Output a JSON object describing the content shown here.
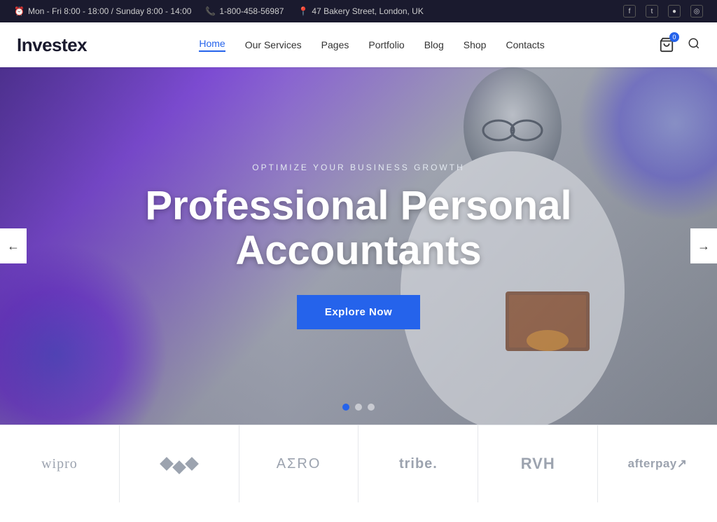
{
  "topbar": {
    "hours": "Mon - Fri 8:00 - 18:00 / Sunday 8:00 - 14:00",
    "phone": "1-800-458-56987",
    "address": "47 Bakery Street, London, UK"
  },
  "header": {
    "logo": "Investex",
    "nav": [
      {
        "label": "Home",
        "active": true
      },
      {
        "label": "Our Services",
        "active": false
      },
      {
        "label": "Pages",
        "active": false
      },
      {
        "label": "Portfolio",
        "active": false
      },
      {
        "label": "Blog",
        "active": false
      },
      {
        "label": "Shop",
        "active": false
      },
      {
        "label": "Contacts",
        "active": false
      }
    ],
    "cart_count": "0"
  },
  "hero": {
    "subtitle": "Optimize Your Business Growth",
    "title": "Professional Personal Accountants",
    "button_label": "Explore Now",
    "dots": [
      {
        "active": true
      },
      {
        "active": false
      },
      {
        "active": false
      }
    ],
    "arrow_left": "←",
    "arrow_right": "→"
  },
  "clients": [
    {
      "label": "wipro",
      "type": "text"
    },
    {
      "label": "◆◆◆",
      "type": "diamonds"
    },
    {
      "label": "AΣRO",
      "type": "text"
    },
    {
      "label": "tribe.",
      "type": "text"
    },
    {
      "label": "RVH",
      "type": "text"
    },
    {
      "label": "afterpay↗",
      "type": "text"
    }
  ],
  "social": [
    {
      "icon": "f",
      "name": "facebook"
    },
    {
      "icon": "t",
      "name": "twitter"
    },
    {
      "icon": "●",
      "name": "web"
    },
    {
      "icon": "◎",
      "name": "instagram"
    }
  ]
}
